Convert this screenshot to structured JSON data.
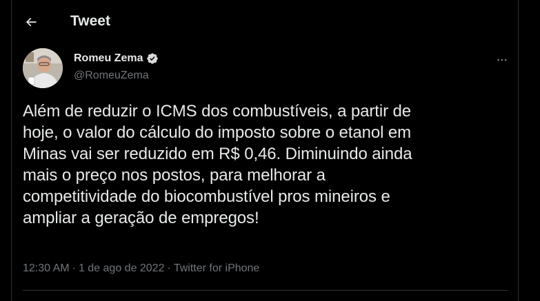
{
  "header": {
    "back_icon": "arrow-left-icon",
    "title": "Tweet"
  },
  "author": {
    "name": "Romeu Zema",
    "verified_icon": "verified-badge-icon",
    "handle": "@RomeuZema"
  },
  "tweet": {
    "text": "Além de reduzir o ICMS dos combustíveis, a partir de\nhoje, o valor do cálculo do imposto sobre o etanol em\nMinas vai ser reduzido em R$ 0,46. Diminuindo ainda\nmais o preço nos postos, para melhorar a\ncompetitividade do biocombustível pros mineiros e\nampliar a geração de empregos!",
    "time": "12:30 AM",
    "separator": "·",
    "date": "1 de ago de 2022",
    "source": "Twitter for iPhone"
  },
  "colors": {
    "background": "#000000",
    "text_primary": "#e7e9ea",
    "text_secondary": "#71767b",
    "border": "#2f3336",
    "verified_badge": "#d9d9d9"
  }
}
